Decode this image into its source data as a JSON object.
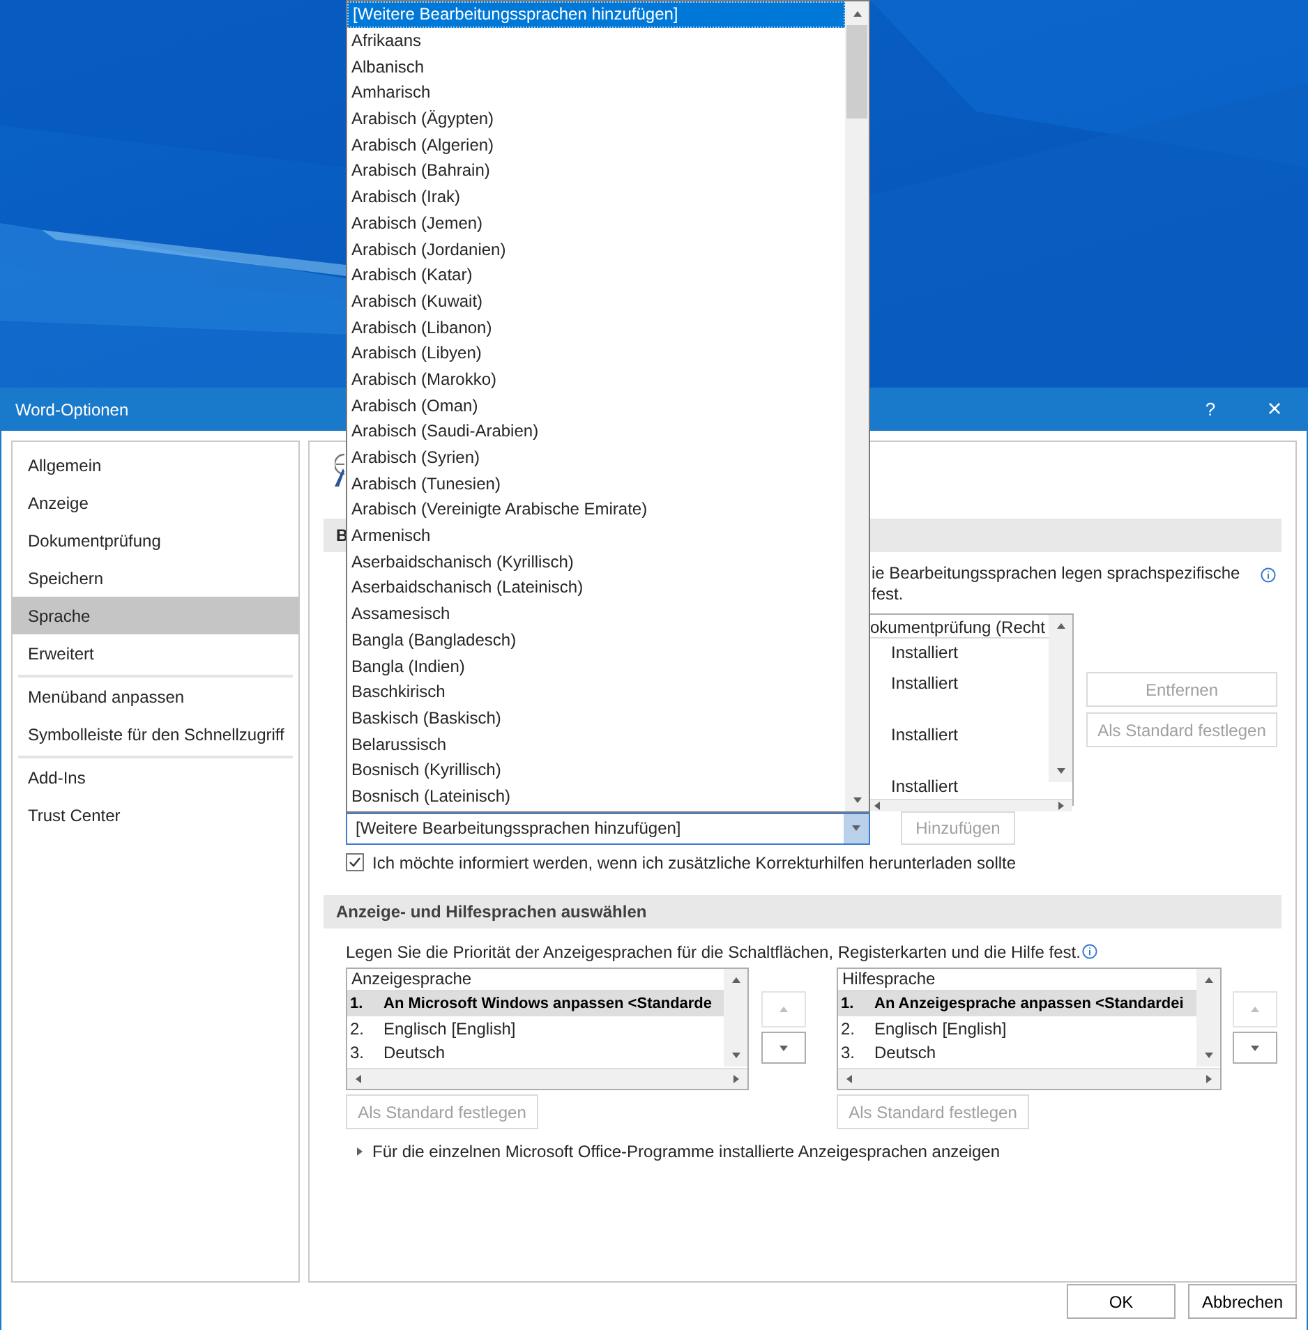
{
  "window": {
    "title": "Word-Optionen",
    "help": "?",
    "close": "×"
  },
  "sidebar": {
    "groups": [
      [
        {
          "label": "Allgemein",
          "selected": false
        },
        {
          "label": "Anzeige",
          "selected": false
        },
        {
          "label": "Dokumentprüfung",
          "selected": false
        },
        {
          "label": "Speichern",
          "selected": false
        },
        {
          "label": "Sprache",
          "selected": true
        },
        {
          "label": "Erweitert",
          "selected": false
        }
      ],
      [
        {
          "label": "Menüband anpassen",
          "selected": false
        },
        {
          "label": "Symbolleiste für den Schnellzugriff",
          "selected": false
        }
      ],
      [
        {
          "label": "Add-Ins",
          "selected": false
        },
        {
          "label": "Trust Center",
          "selected": false
        }
      ]
    ]
  },
  "editing_section": {
    "header": "B",
    "description": [
      "ie Bearbeitungssprachen legen sprachspezifische",
      "fest."
    ],
    "list": {
      "column": "okumentprüfung (Recht",
      "rows": [
        "Installiert",
        "Installiert",
        "Installiert",
        "Installiert"
      ]
    },
    "buttons": [
      {
        "label": "Entfernen",
        "disabled": true
      },
      {
        "label": "Als Standard festlegen",
        "disabled": true
      }
    ],
    "combo": {
      "value": "[Weitere Bearbeitungssprachen hinzufügen]"
    },
    "add_button": {
      "label": "Hinzufügen",
      "disabled": true
    },
    "notify_checkbox": {
      "label": "Ich möchte informiert werden, wenn ich zusätzliche Korrekturhilfen herunterladen sollte",
      "checked": true
    }
  },
  "display_section": {
    "header": "Anzeige- und Hilfesprachen auswählen",
    "description": "Legen Sie die Priorität der Anzeigesprachen für die Schaltflächen, Registerkarten und die Hilfe fest.",
    "lists": [
      {
        "column": "Anzeigesprache",
        "rows": [
          {
            "number": "1.",
            "label": "An Microsoft Windows anpassen <Standarde",
            "selected": true
          },
          {
            "number": "2.",
            "label": "Englisch [English]",
            "selected": false
          },
          {
            "number": "3.",
            "label": "Deutsch",
            "selected": false
          }
        ],
        "up": {
          "disabled": true
        },
        "down": {
          "disabled": false
        },
        "default_button": {
          "label": "Als Standard festlegen",
          "disabled": true
        }
      },
      {
        "column": "Hilfesprache",
        "rows": [
          {
            "number": "1.",
            "label": "An Anzeigesprache anpassen <Standardei",
            "selected": true
          },
          {
            "number": "2.",
            "label": "Englisch [English]",
            "selected": false
          },
          {
            "number": "3.",
            "label": "Deutsch",
            "selected": false
          }
        ],
        "up": {
          "disabled": true
        },
        "down": {
          "disabled": false
        },
        "default_button": {
          "label": "Als Standard festlegen",
          "disabled": true
        }
      }
    ],
    "expander": {
      "label": "Für die einzelnen Microsoft Office-Programme installierte Anzeigesprachen anzeigen",
      "expanded": false
    }
  },
  "dropdown": {
    "items": [
      {
        "label": "[Weitere Bearbeitungssprachen hinzufügen]",
        "selected": true
      },
      {
        "label": "Afrikaans",
        "selected": false
      },
      {
        "label": "Albanisch",
        "selected": false
      },
      {
        "label": "Amharisch",
        "selected": false
      },
      {
        "label": "Arabisch (Ägypten)",
        "selected": false
      },
      {
        "label": "Arabisch (Algerien)",
        "selected": false
      },
      {
        "label": "Arabisch (Bahrain)",
        "selected": false
      },
      {
        "label": "Arabisch (Irak)",
        "selected": false
      },
      {
        "label": "Arabisch (Jemen)",
        "selected": false
      },
      {
        "label": "Arabisch (Jordanien)",
        "selected": false
      },
      {
        "label": "Arabisch (Katar)",
        "selected": false
      },
      {
        "label": "Arabisch (Kuwait)",
        "selected": false
      },
      {
        "label": "Arabisch (Libanon)",
        "selected": false
      },
      {
        "label": "Arabisch (Libyen)",
        "selected": false
      },
      {
        "label": "Arabisch (Marokko)",
        "selected": false
      },
      {
        "label": "Arabisch (Oman)",
        "selected": false
      },
      {
        "label": "Arabisch (Saudi-Arabien)",
        "selected": false
      },
      {
        "label": "Arabisch (Syrien)",
        "selected": false
      },
      {
        "label": "Arabisch (Tunesien)",
        "selected": false
      },
      {
        "label": "Arabisch (Vereinigte Arabische Emirate)",
        "selected": false
      },
      {
        "label": "Armenisch",
        "selected": false
      },
      {
        "label": "Aserbaidschanisch (Kyrillisch)",
        "selected": false
      },
      {
        "label": "Aserbaidschanisch (Lateinisch)",
        "selected": false
      },
      {
        "label": "Assamesisch",
        "selected": false
      },
      {
        "label": "Bangla (Bangladesch)",
        "selected": false
      },
      {
        "label": "Bangla (Indien)",
        "selected": false
      },
      {
        "label": "Baschkirisch",
        "selected": false
      },
      {
        "label": "Baskisch (Baskisch)",
        "selected": false
      },
      {
        "label": "Belarussisch",
        "selected": false
      },
      {
        "label": "Bosnisch (Kyrillisch)",
        "selected": false
      },
      {
        "label": "Bosnisch (Lateinisch)",
        "selected": false
      }
    ]
  },
  "footer": {
    "buttons": [
      "OK",
      "Abbrechen"
    ]
  }
}
